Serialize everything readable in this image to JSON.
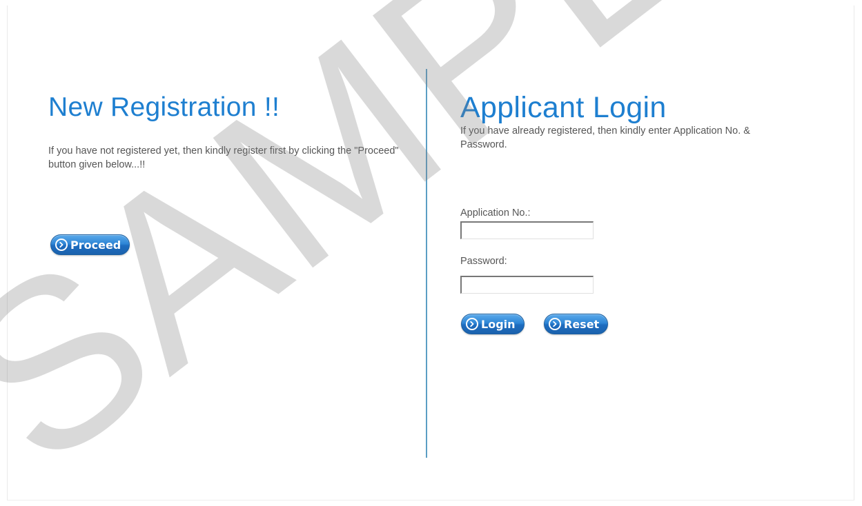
{
  "registration": {
    "heading": "New Registration !!",
    "description": "If you have not registered yet, then kindly register first by clicking the \"Proceed\" button given below...!!",
    "proceed_label": "Proceed"
  },
  "login": {
    "heading": "Applicant Login",
    "description": "If you have already registered, then kindly enter Application No. & Password.",
    "application_no_label": "Application No.:",
    "application_no_value": "",
    "password_label": "Password:",
    "password_value": "",
    "login_label": "Login",
    "reset_label": "Reset"
  },
  "watermark": {
    "text": "SAMPLE"
  },
  "colors": {
    "heading": "#1e7fd0",
    "button": "#2e86d6",
    "divider": "#5b9ec4"
  },
  "icons": {
    "button_icon": "circle-arrow-right-icon"
  }
}
